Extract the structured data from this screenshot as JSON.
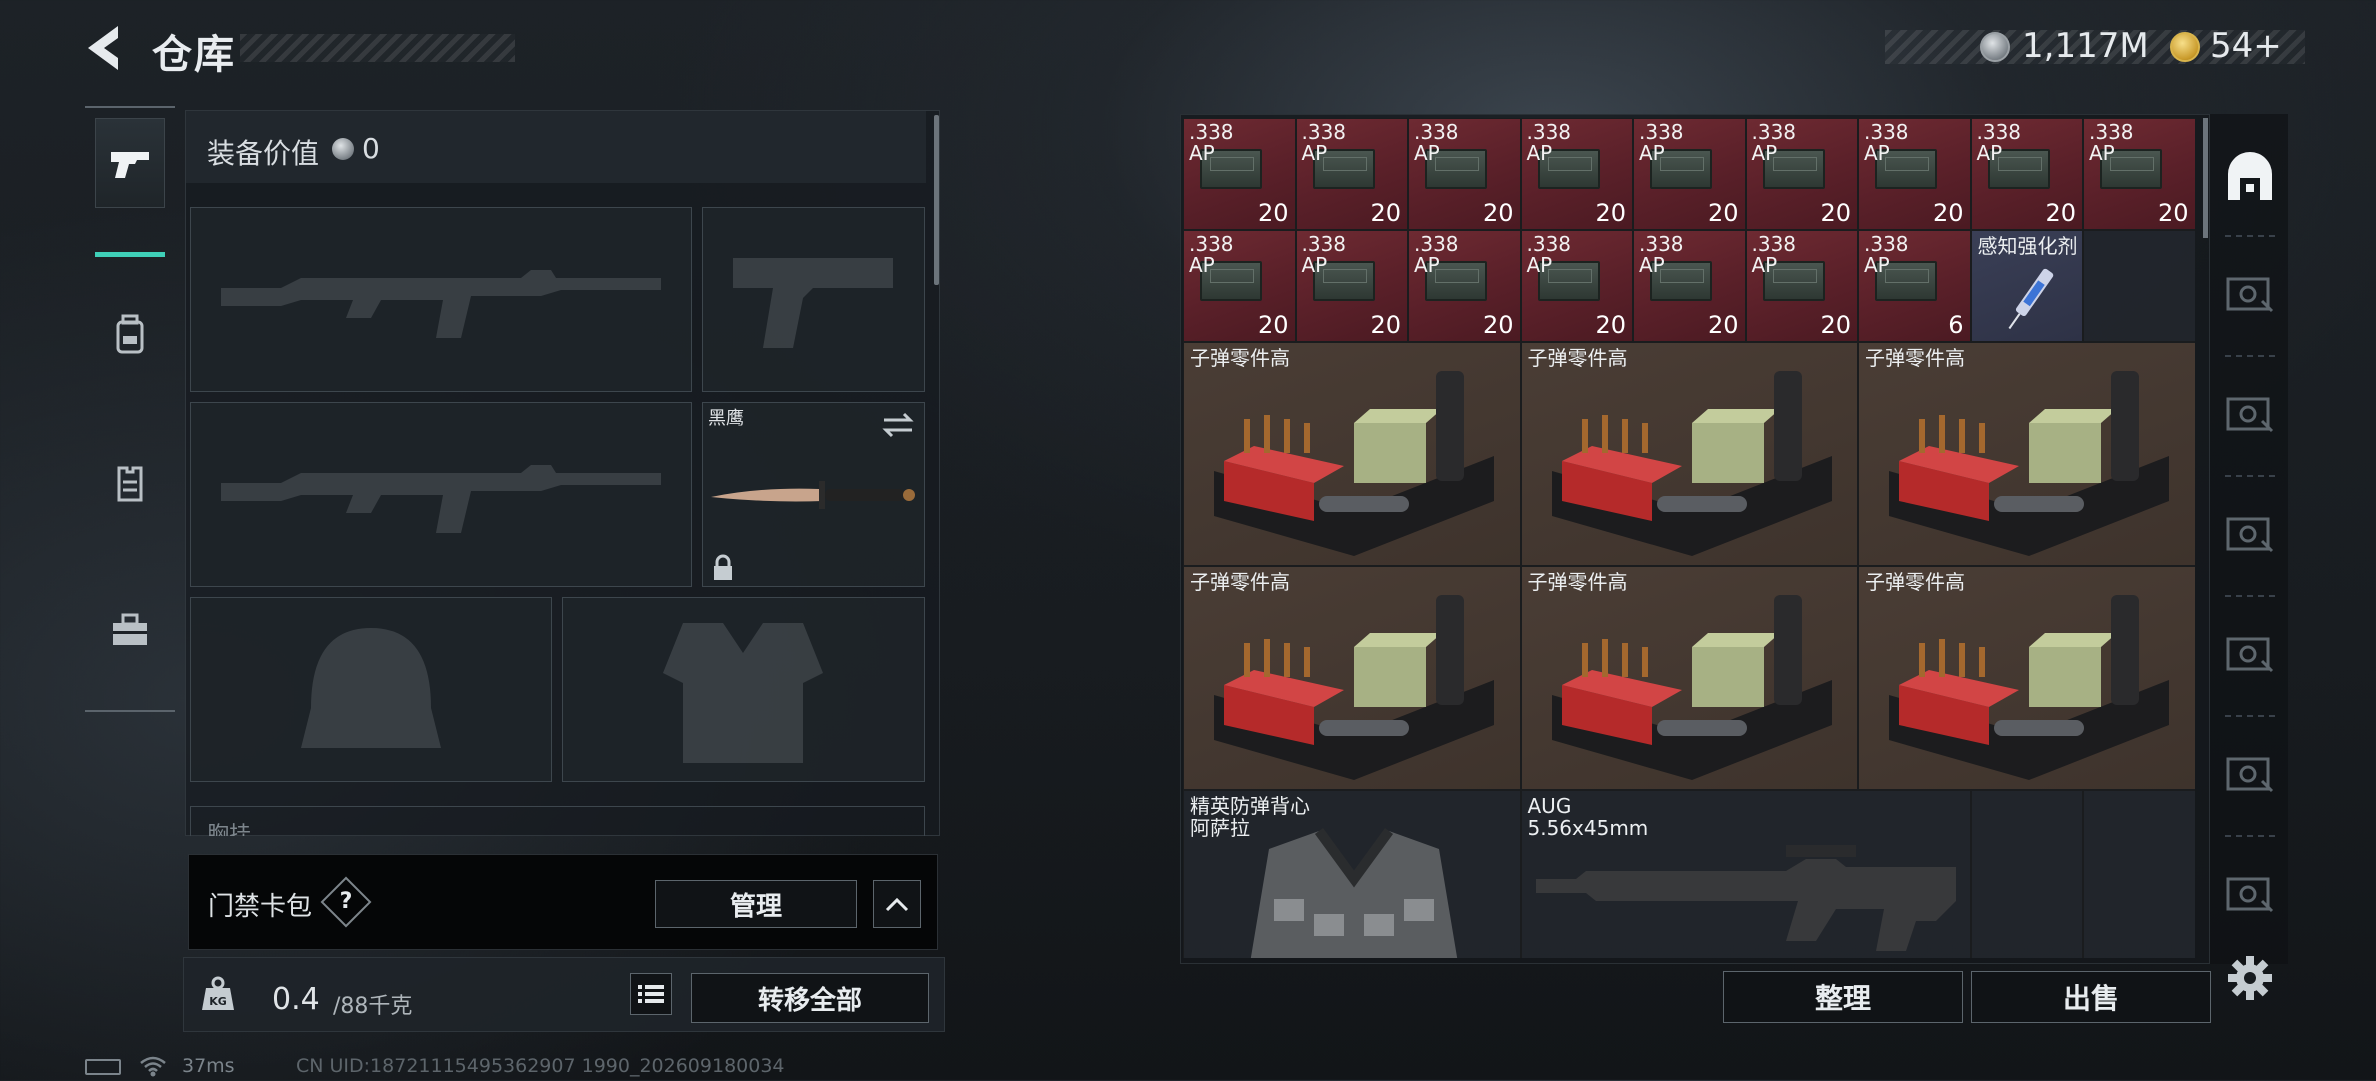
{
  "header": {
    "title": "仓库",
    "currency1": "1,117M",
    "currency2": "54+"
  },
  "tabs": [
    "weapons",
    "backpack",
    "vest",
    "toolbox"
  ],
  "equipment": {
    "label": "装备价值",
    "value": "0",
    "melee_name": "黑鹰",
    "cut_label": "胸挂"
  },
  "access_card": {
    "label": "门禁卡包",
    "help": "?",
    "manage": "管理"
  },
  "capacity": {
    "current": "0.4",
    "max": "/88千克",
    "transfer_all": "转移全部"
  },
  "storage": {
    "ammo_name": ".338\nAP",
    "ammo_counts": [
      20,
      20,
      20,
      20,
      20,
      20,
      20,
      20,
      20,
      20,
      20,
      20,
      20,
      20,
      20,
      6
    ],
    "stimulant": "感知强化剂",
    "parts": [
      "子弹零件高",
      "子弹零件高",
      "子弹零件高",
      "子弹零件高",
      "子弹零件高",
      "子弹零件高"
    ],
    "vest_name": "精英防弹背心\n阿萨拉",
    "rifle_name": "AUG\n5.56x45mm",
    "sort": "整理",
    "sell": "出售"
  },
  "status": {
    "ping": "37ms",
    "uid": "CN UID:18721115495362907 1990_202609180034"
  },
  "colors": {
    "accent": "#3fd0b8",
    "ammo_cell": "#5a2029",
    "parts_cell": "#3e332c",
    "stim_cell": "#2e3246"
  }
}
